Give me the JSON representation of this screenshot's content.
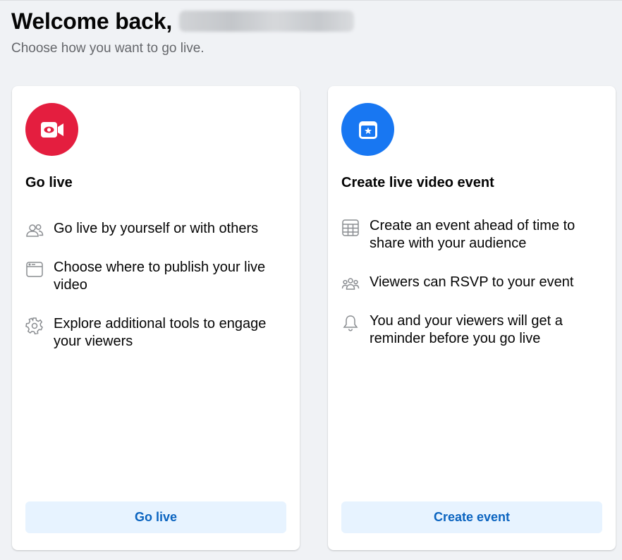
{
  "header": {
    "welcome": "Welcome back,",
    "subtitle": "Choose how you want to go live."
  },
  "cards": [
    {
      "title": "Go live",
      "icon": "video-camera-icon",
      "icon_color": "#e41e3f",
      "features": [
        {
          "icon": "people-icon",
          "text": "Go live by yourself or with others"
        },
        {
          "icon": "window-icon",
          "text": "Choose where to publish your live video"
        },
        {
          "icon": "gear-icon",
          "text": "Explore additional tools to engage your viewers"
        }
      ],
      "button": "Go live"
    },
    {
      "title": "Create live video event",
      "icon": "calendar-star-icon",
      "icon_color": "#1877f2",
      "features": [
        {
          "icon": "calendar-grid-icon",
          "text": "Create an event ahead of time to share with your audience"
        },
        {
          "icon": "group-icon",
          "text": "Viewers can RSVP to your event"
        },
        {
          "icon": "bell-icon",
          "text": "You and your viewers will get a reminder before you go live"
        }
      ],
      "button": "Create event"
    }
  ],
  "colors": {
    "background": "#f0f2f5",
    "button_bg": "#e7f3ff",
    "button_text": "#0b64c0",
    "secondary_text": "#65676b"
  }
}
